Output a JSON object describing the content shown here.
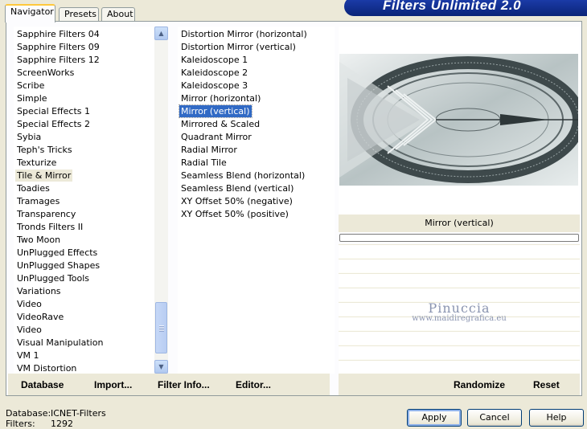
{
  "banner": {
    "title": "Filters Unlimited 2.0"
  },
  "tabs": [
    {
      "label": "Navigator"
    },
    {
      "label": "Presets"
    },
    {
      "label": "About"
    }
  ],
  "categories": {
    "items": [
      "Sapphire Filters 04",
      "Sapphire Filters 09",
      "Sapphire Filters 12",
      "ScreenWorks",
      "Scribe",
      "Simple",
      "Special Effects 1",
      "Special Effects 2",
      "Sybia",
      "Teph's Tricks",
      "Texturize",
      "Tile & Mirror",
      "Toadies",
      "Tramages",
      "Transparency",
      "Tronds Filters II",
      "Two Moon",
      "UnPlugged Effects",
      "UnPlugged Shapes",
      "UnPlugged Tools",
      "Variations",
      "Video",
      "VideoRave",
      "Video",
      "Visual Manipulation",
      "VM 1",
      "VM Distortion"
    ],
    "selected": "Tile & Mirror"
  },
  "filters": {
    "items": [
      "Distortion Mirror (horizontal)",
      "Distortion Mirror (vertical)",
      "Kaleidoscope 1",
      "Kaleidoscope 2",
      "Kaleidoscope 3",
      "Mirror (horizontal)",
      "Mirror (vertical)",
      "Mirrored & Scaled",
      "Quadrant Mirror",
      "Radial Mirror",
      "Radial Tile",
      "Seamless Blend (horizontal)",
      "Seamless Blend (vertical)",
      "XY Offset 50% (negative)",
      "XY Offset 50% (positive)"
    ],
    "selected": "Mirror (vertical)"
  },
  "preview": {
    "filter_name": "Mirror (vertical)",
    "progress": 0
  },
  "watermark": {
    "name": "Pinuccia",
    "url": "www.maidiregrafica.eu"
  },
  "buttons": {
    "database": "Database",
    "import": "Import...",
    "filter_info": "Filter Info...",
    "editor": "Editor...",
    "randomize": "Randomize",
    "reset": "Reset",
    "apply": "Apply",
    "cancel": "Cancel",
    "help": "Help"
  },
  "status": {
    "database_label": "Database:",
    "database_value": "ICNET-Filters",
    "filters_label": "Filters:",
    "filters_value": "1292"
  },
  "colors": {
    "selection": "#316ac5",
    "banner": "#0a2478",
    "tab_highlight": "#ffc83c"
  }
}
